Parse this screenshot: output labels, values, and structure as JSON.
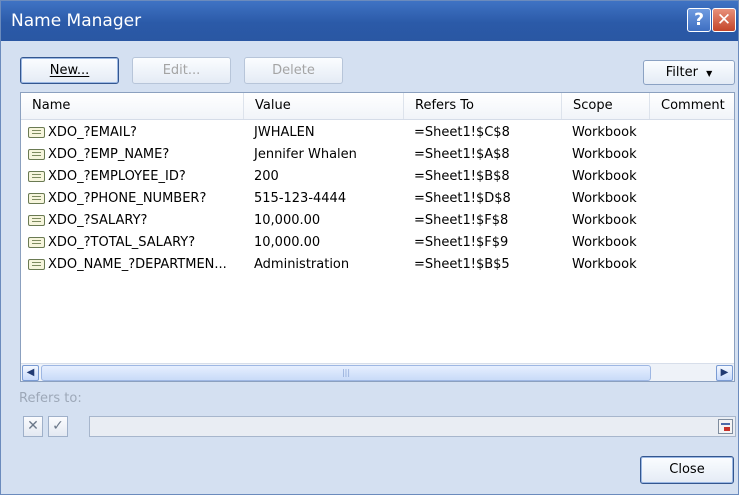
{
  "window": {
    "title": "Name Manager",
    "help_glyph": "?",
    "close_glyph": "✕"
  },
  "toolbar": {
    "new_label": "New...",
    "edit_label": "Edit...",
    "delete_label": "Delete",
    "filter_label": "Filter",
    "filter_arrow": "▼"
  },
  "columns": [
    "Name",
    "Value",
    "Refers To",
    "Scope",
    "Comment"
  ],
  "rows": [
    {
      "name": "XDO_?EMAIL?",
      "value": "JWHALEN",
      "refers": "=Sheet1!$C$8",
      "scope": "Workbook"
    },
    {
      "name": "XDO_?EMP_NAME?",
      "value": "Jennifer Whalen",
      "refers": "=Sheet1!$A$8",
      "scope": "Workbook"
    },
    {
      "name": "XDO_?EMPLOYEE_ID?",
      "value": "200",
      "refers": "=Sheet1!$B$8",
      "scope": "Workbook"
    },
    {
      "name": "XDO_?PHONE_NUMBER?",
      "value": "515-123-4444",
      "refers": "=Sheet1!$D$8",
      "scope": "Workbook"
    },
    {
      "name": "XDO_?SALARY?",
      "value": "10,000.00",
      "refers": "=Sheet1!$F$8",
      "scope": "Workbook"
    },
    {
      "name": "XDO_?TOTAL_SALARY?",
      "value": "10,000.00",
      "refers": "=Sheet1!$F$9",
      "scope": "Workbook"
    },
    {
      "name": "XDO_NAME_?DEPARTMEN...",
      "value": "Administration",
      "refers": "=Sheet1!$B$5",
      "scope": "Workbook"
    }
  ],
  "scrollbar": {
    "left_glyph": "◀",
    "right_glyph": "▶",
    "grip": "|||"
  },
  "refers_to": {
    "label": "Refers to:",
    "value": "",
    "cancel_glyph": "✕",
    "confirm_glyph": "✓"
  },
  "footer": {
    "close_label": "Close"
  },
  "colors": {
    "titlebar": "#2b5aa8",
    "dialog_bg": "#d4e0f1",
    "close_button": "#c4452a"
  },
  "icons": [
    "help-icon",
    "close-icon",
    "dropdown-arrow-icon",
    "name-range-icon",
    "scroll-left-icon",
    "scroll-right-icon",
    "cancel-x-icon",
    "confirm-check-icon",
    "collapse-dialog-icon"
  ]
}
